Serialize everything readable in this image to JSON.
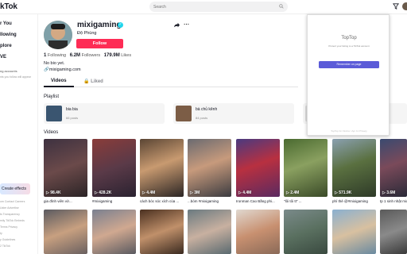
{
  "header": {
    "logo": "kTok",
    "search_placeholder": "Search"
  },
  "sidebar": {
    "items": [
      {
        "label": "r You"
      },
      {
        "label": "llowing"
      },
      {
        "label": "plore"
      },
      {
        "label": "VE"
      }
    ],
    "accounts_title": "ng accounts",
    "accounts_note": "nts you follow will appear",
    "create_effects": "Create effects",
    "footer_links": [
      "om  Contact  Careers",
      "Uster  Advertise",
      "ts  Transparency",
      "mily  TikTok Embeds",
      "  Terms  Privacy",
      "ty",
      "y Guidelines",
      "2 TikTok"
    ]
  },
  "profile": {
    "username": "mixigaming",
    "verified_mark": "✓",
    "nickname": "Độ Phùng",
    "follow_label": "Follow",
    "following_count": "1",
    "following_label": "Following",
    "followers_count": "6.2M",
    "followers_label": "Followers",
    "likes_count": "179.9M",
    "likes_label": "Likes",
    "bio": "No bio yet.",
    "link": "mixigaming.com"
  },
  "tabs": {
    "videos": "Videos",
    "liked": "Liked"
  },
  "playlists": {
    "title": "Playlist",
    "items": [
      {
        "title": "bia bia",
        "count": "66 posts"
      },
      {
        "title": "bà chủ kênh",
        "count": "84 posts"
      },
      {
        "title": "",
        "count": ""
      }
    ]
  },
  "videos": {
    "title": "Videos",
    "items": [
      {
        "views": "98.4K",
        "caption": "gia đình viên vờ..."
      },
      {
        "views": "428.2K",
        "caption": "#mixigaming"
      },
      {
        "views": "4.4M",
        "caption": "cách bóc sóc xích của ..."
      },
      {
        "views": "3M",
        "caption": "...bóm #mixigaming"
      },
      {
        "views": "4.4M",
        "caption": "Ironman Cao Bằng phi..."
      },
      {
        "views": "2.4M",
        "caption": "\"lôi tôi tt\" ..."
      },
      {
        "views": "571.9K",
        "caption": "phí thẻ @#mixigaming"
      },
      {
        "views": "3.6M",
        "caption": "tp 1 sinh nhật mix"
      }
    ]
  },
  "popup": {
    "title": "TopTop",
    "description": "Protect your listing to a TikTok account",
    "button": "Remember on page",
    "footer": "TopTop for Firefox / Apr 11 Privacy"
  },
  "colors": {
    "follow": "#fe2c55",
    "verified": "#20d5ec",
    "popup_button": "#5b5bd8"
  }
}
